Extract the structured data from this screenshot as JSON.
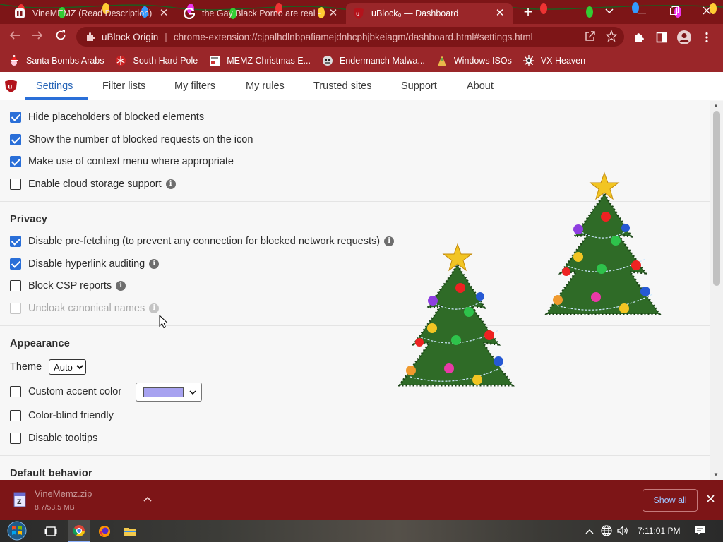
{
  "browser": {
    "tabs": [
      {
        "title": "VineMEMZ (Read Description) : F",
        "icon": "reddit-icon",
        "active": false
      },
      {
        "title": "the Gay Black Porno are real - Go",
        "icon": "google-icon",
        "active": false
      },
      {
        "title": "uBlock₀ — Dashboard",
        "icon": "ublock-icon",
        "active": true
      }
    ],
    "new_tab_label": "+",
    "window_controls": {
      "dropdown": "⌵",
      "minimize": "—",
      "restore": "❐",
      "close": "✕"
    },
    "omnibox": {
      "site_name": "uBlock Origin",
      "separator": "|",
      "url": "chrome-extension://cjpalhdlnbpafiamejdnhcphjbkeiagm/dashboard.html#settings.html"
    },
    "bookmarks": [
      {
        "label": "Santa Bombs Arabs",
        "icon": "santa-icon"
      },
      {
        "label": "South Hard Pole",
        "icon": "snowflake-icon"
      },
      {
        "label": "MEMZ Christmas E...",
        "icon": "memz-icon"
      },
      {
        "label": "Endermanch Malwa...",
        "icon": "endermanch-icon"
      },
      {
        "label": "Windows ISOs",
        "icon": "windows-icon"
      },
      {
        "label": "VX Heaven",
        "icon": "vx-heaven-icon"
      }
    ]
  },
  "dashboard": {
    "tabs": [
      {
        "label": "Settings",
        "selected": true
      },
      {
        "label": "Filter lists",
        "selected": false
      },
      {
        "label": "My filters",
        "selected": false
      },
      {
        "label": "My rules",
        "selected": false
      },
      {
        "label": "Trusted sites",
        "selected": false
      },
      {
        "label": "Support",
        "selected": false
      },
      {
        "label": "About",
        "selected": false
      }
    ],
    "general_options": [
      {
        "label": "Hide placeholders of blocked elements",
        "checked": true,
        "info": false
      },
      {
        "label": "Show the number of blocked requests on the icon",
        "checked": true,
        "info": false
      },
      {
        "label": "Make use of context menu where appropriate",
        "checked": true,
        "info": false
      },
      {
        "label": "Enable cloud storage support",
        "checked": false,
        "info": true
      }
    ],
    "privacy": {
      "title": "Privacy",
      "options": [
        {
          "label": "Disable pre-fetching (to prevent any connection for blocked network requests)",
          "checked": true,
          "info": true,
          "disabled": false
        },
        {
          "label": "Disable hyperlink auditing",
          "checked": true,
          "info": true,
          "disabled": false
        },
        {
          "label": "Block CSP reports",
          "checked": false,
          "info": true,
          "disabled": false
        },
        {
          "label": "Uncloak canonical names",
          "checked": false,
          "info": true,
          "disabled": true
        }
      ]
    },
    "appearance": {
      "title": "Appearance",
      "theme_label": "Theme",
      "theme_value": "Auto",
      "custom_accent_label": "Custom accent color",
      "custom_accent_checked": false,
      "accent_color": "#a7a2f0",
      "color_blind_label": "Color-blind friendly",
      "color_blind_checked": false,
      "disable_tooltips_label": "Disable tooltips",
      "disable_tooltips_checked": false
    },
    "default_behavior_title": "Default behavior",
    "accent_blue": "#2a6fd8"
  },
  "downloads": {
    "file_name": "VineMemz.zip",
    "progress": "8.7/53.5 MB",
    "show_all_label": "Show all"
  },
  "taskbar": {
    "clock": "7:11:01 PM",
    "apps": [
      "task-view-icon",
      "chrome-icon",
      "firefox-icon",
      "file-explorer-icon"
    ]
  }
}
